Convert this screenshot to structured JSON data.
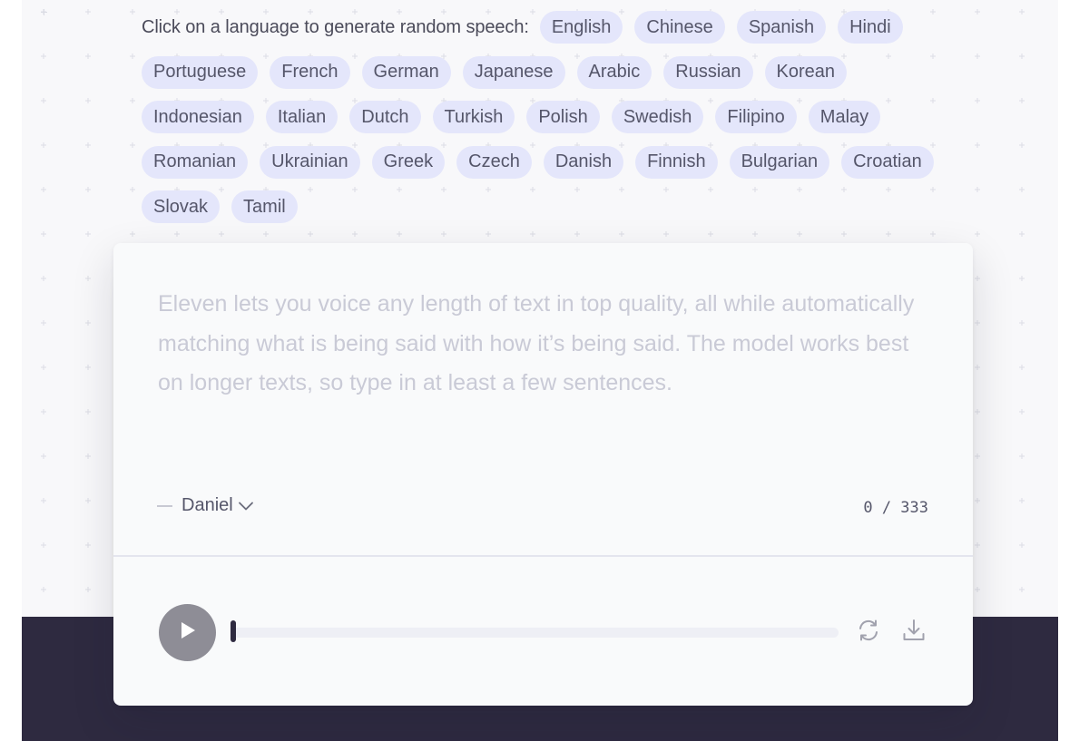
{
  "languages": {
    "prompt": "Click on a language to generate random speech:",
    "rows": [
      [
        "English",
        "Chinese",
        "Spanish",
        "Hindi"
      ],
      [
        "Portuguese",
        "French",
        "German",
        "Japanese",
        "Arabic",
        "Russian",
        "Korean"
      ],
      [
        "Indonesian",
        "Italian",
        "Dutch",
        "Turkish",
        "Polish",
        "Swedish",
        "Filipino",
        "Malay"
      ],
      [
        "Romanian",
        "Ukrainian",
        "Greek",
        "Czech",
        "Danish",
        "Finnish",
        "Bulgarian",
        "Croatian"
      ],
      [
        "Slovak",
        "Tamil"
      ]
    ]
  },
  "editor": {
    "text": "",
    "placeholder": "Eleven lets you voice any length of text in top quality, all while automatically matching what is being said with how it’s being said. The model works best on longer texts, so type in at least a few sentences.",
    "voice": "Daniel",
    "char_count": "0 / 333"
  },
  "player": {
    "progress": 0,
    "play_icon": "play-icon",
    "regenerate_icon": "refresh-icon",
    "download_icon": "download-icon"
  },
  "colors": {
    "chip_bg": "#e4e6fb",
    "footer": "#2e2a40",
    "play_button": "#8e8d96"
  }
}
